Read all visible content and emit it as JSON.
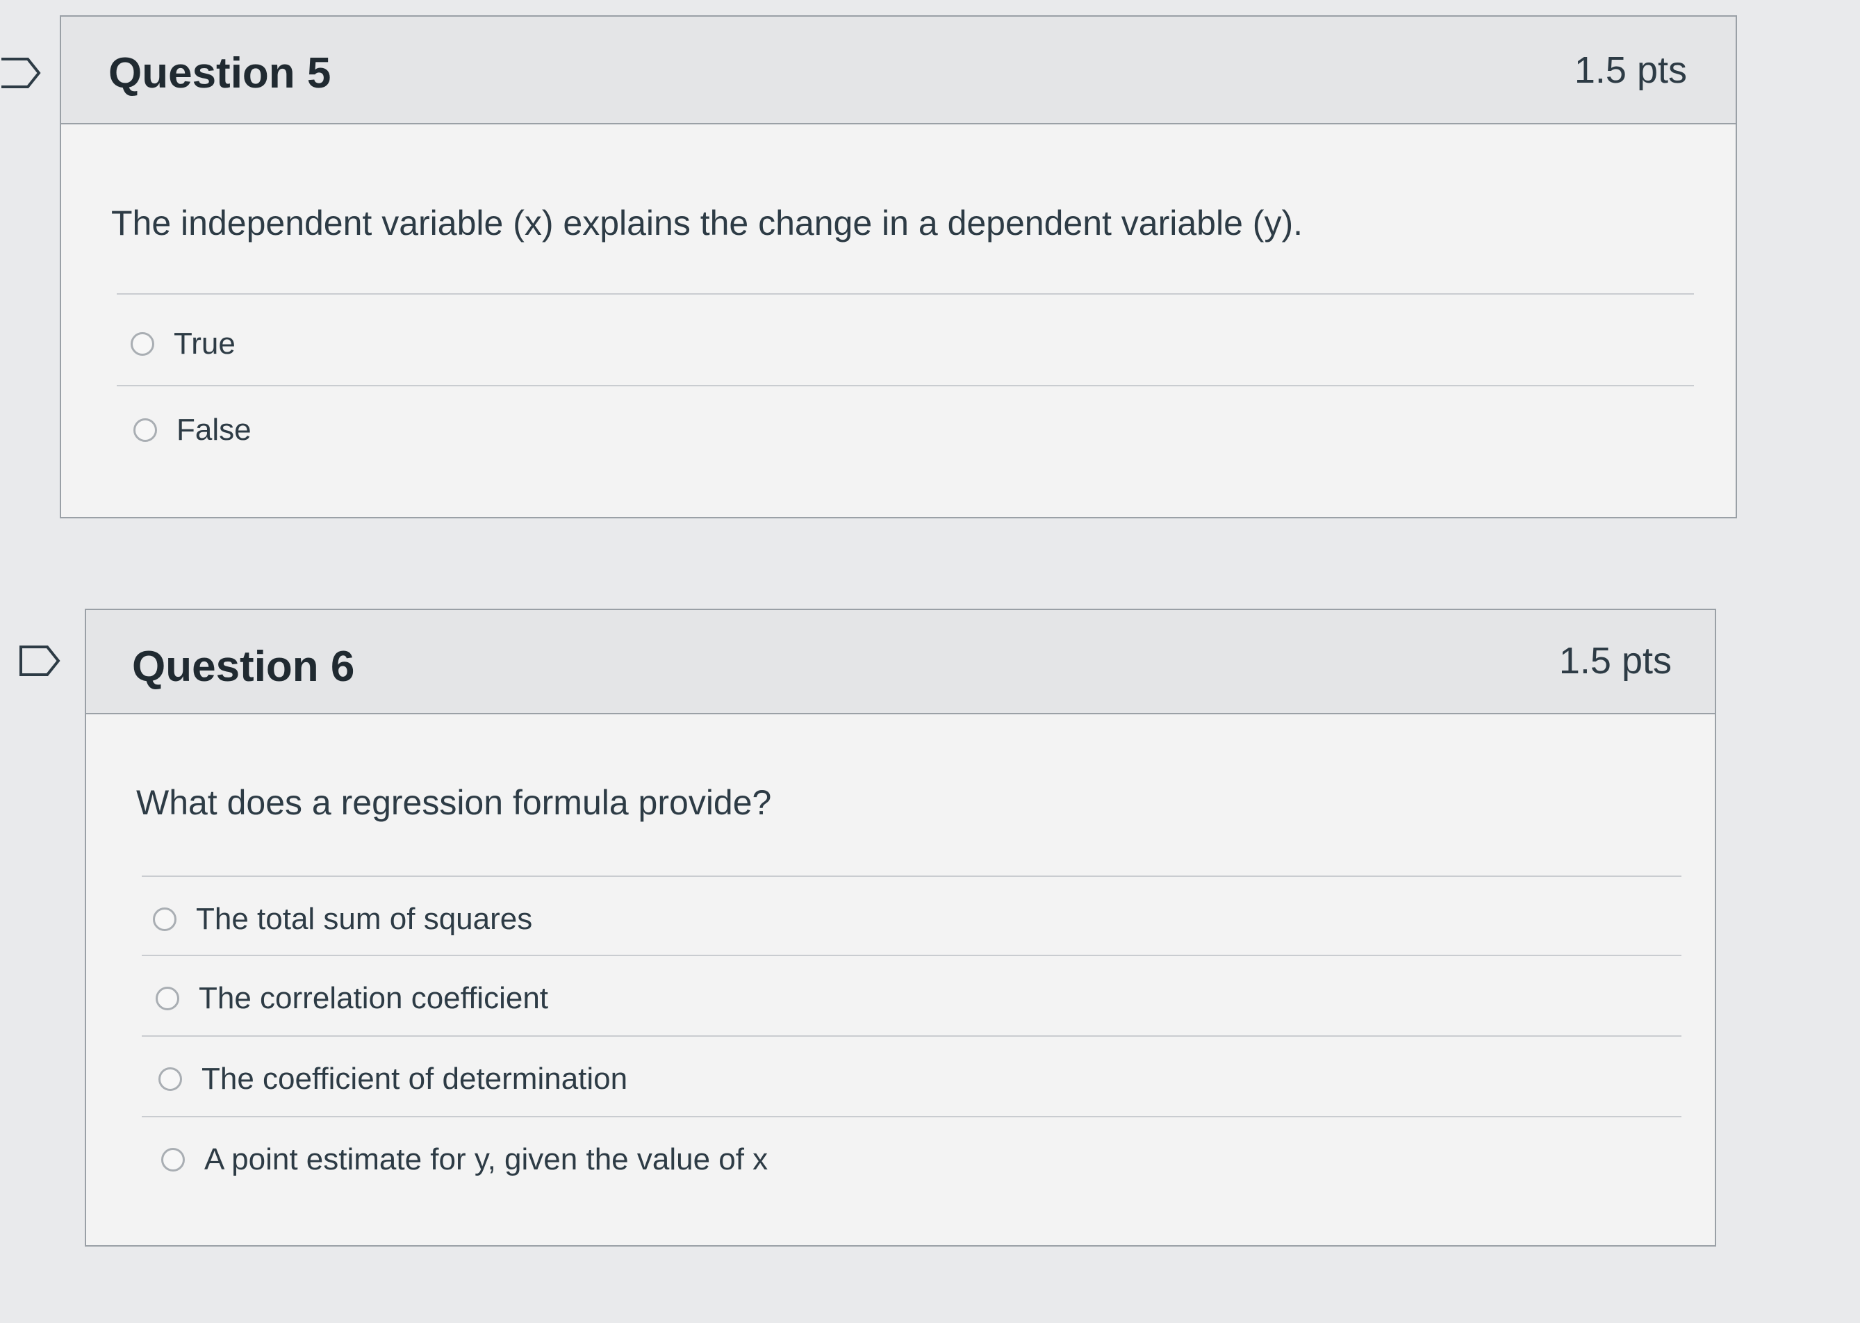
{
  "questions": [
    {
      "title": "Question 5",
      "points": "1.5 pts",
      "text": "The independent variable (x) explains the change in a dependent variable (y).",
      "answers": [
        "True",
        "False"
      ]
    },
    {
      "title": "Question 6",
      "points": "1.5 pts",
      "text": "What does a regression formula provide?",
      "answers": [
        "The total sum of squares",
        "The correlation coefficient",
        "The coefficient of determination",
        "A point estimate for y, given the value of x"
      ]
    }
  ]
}
